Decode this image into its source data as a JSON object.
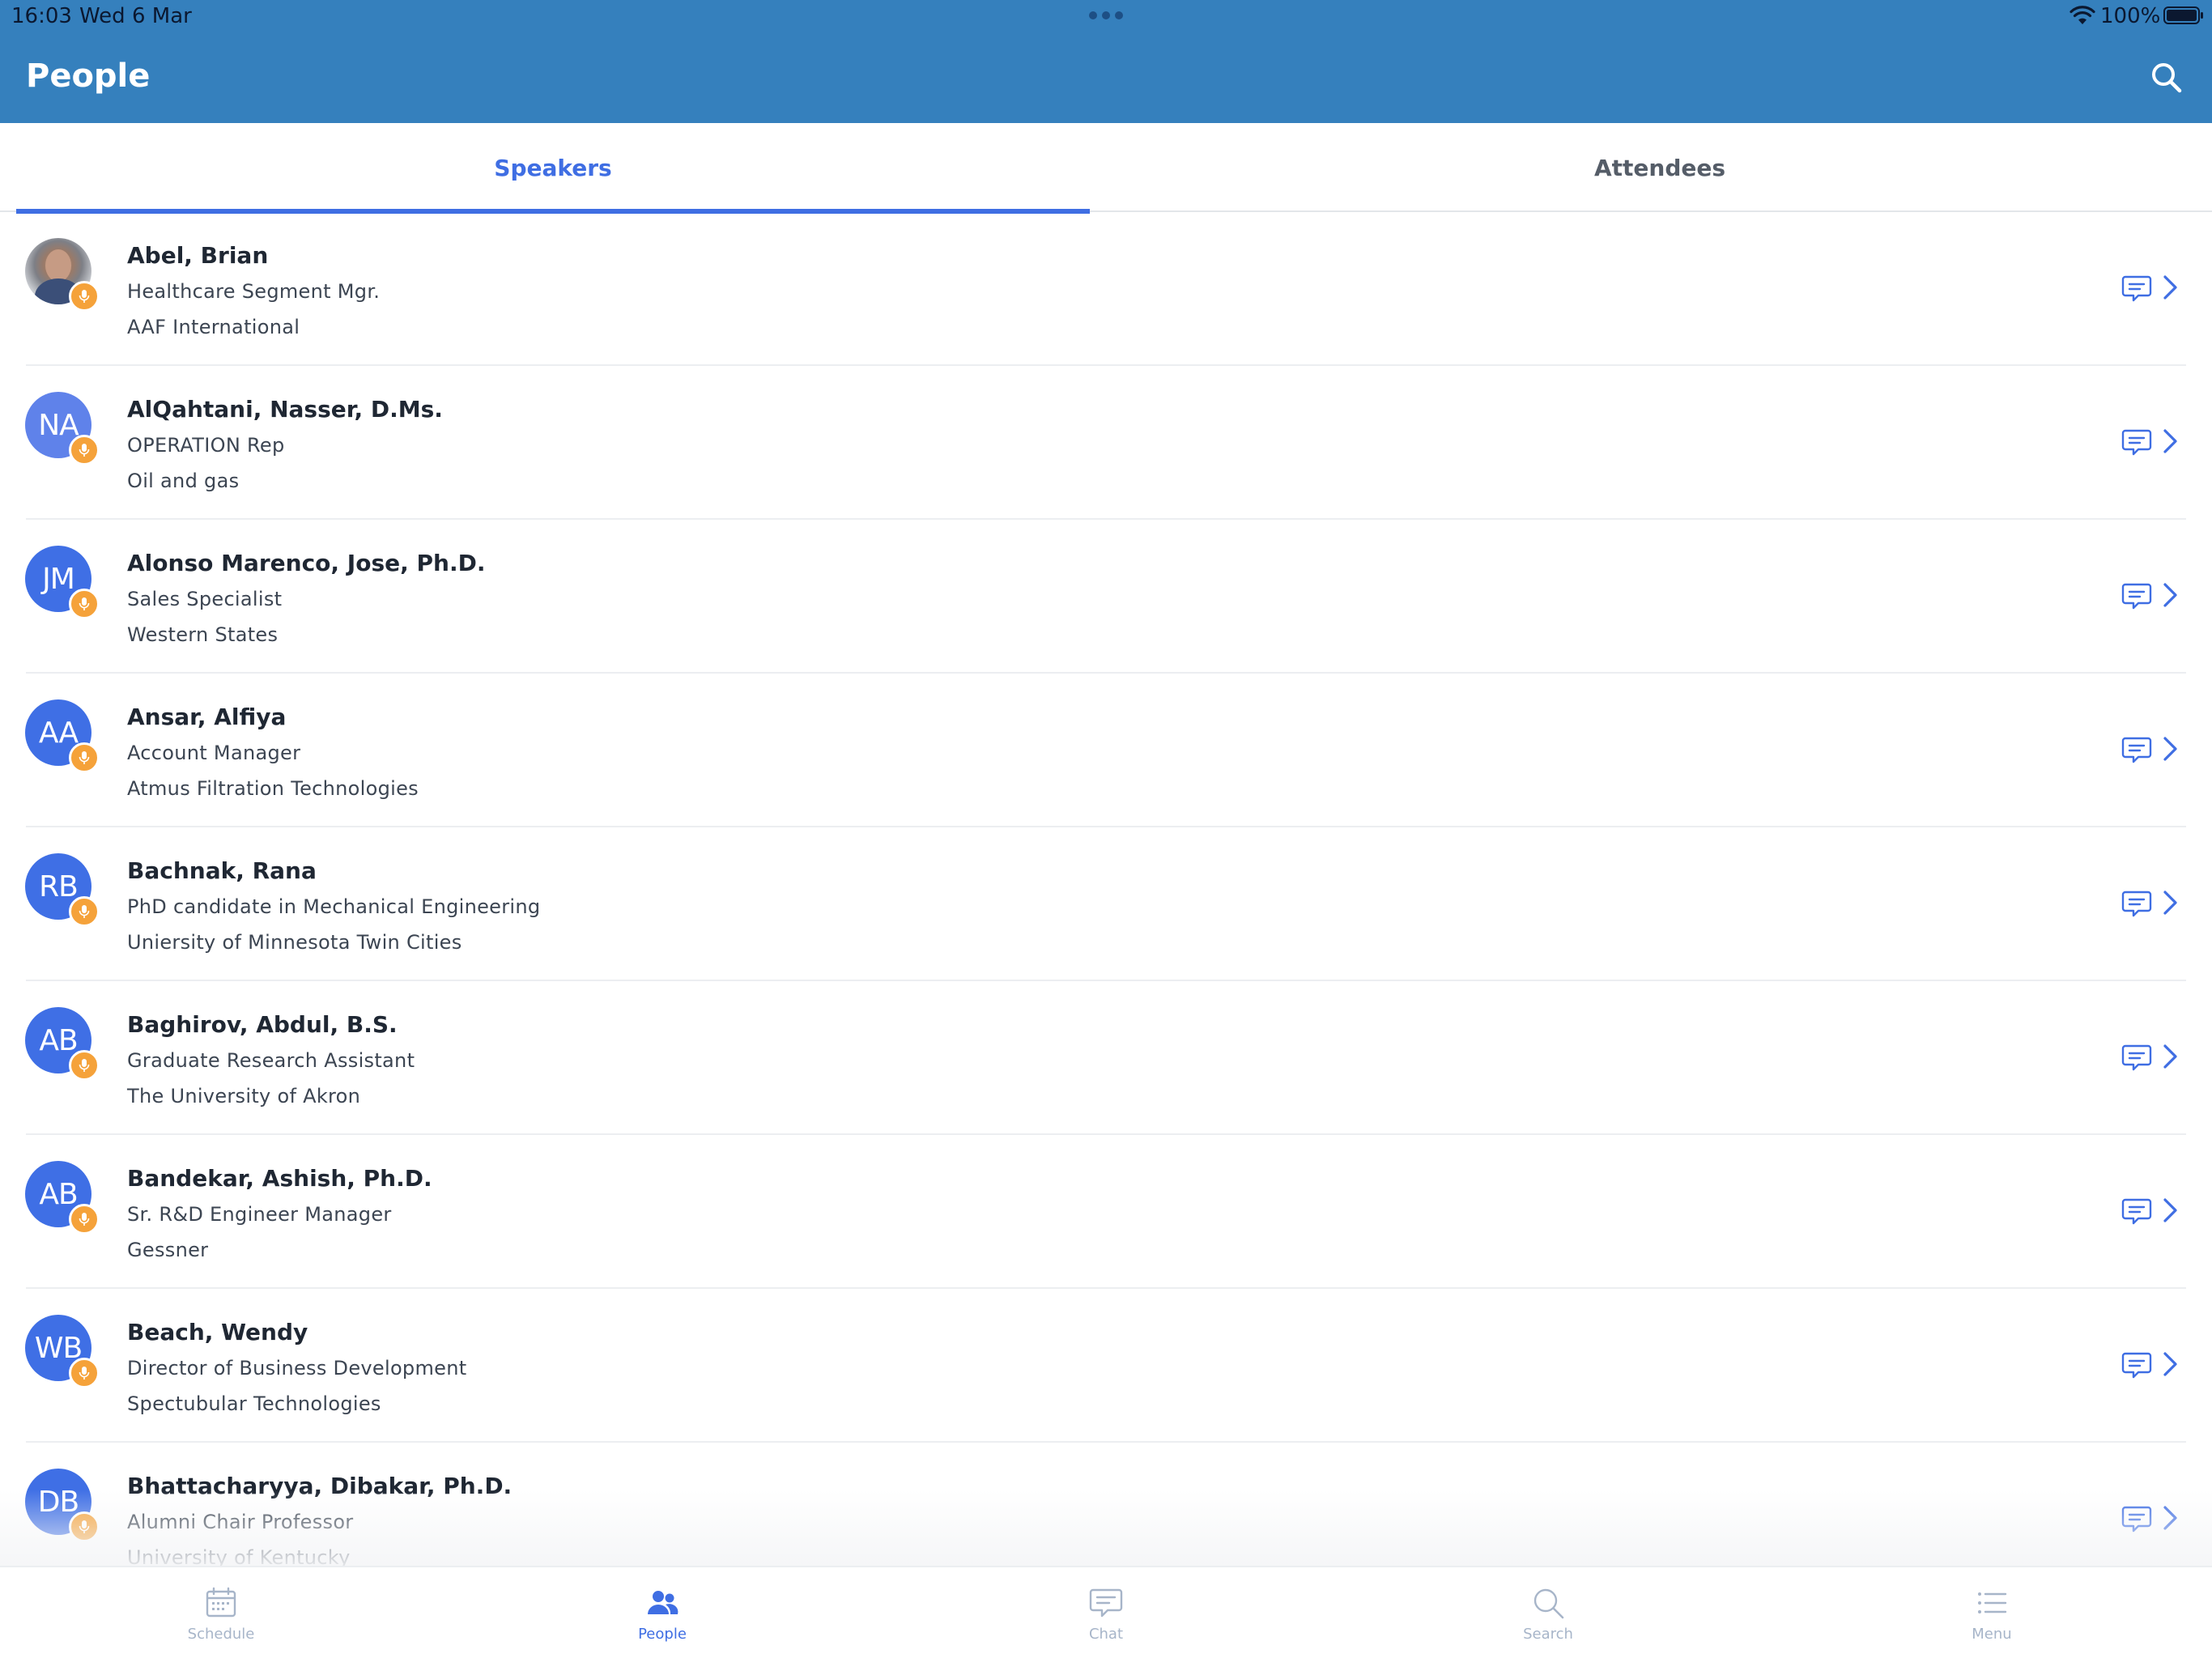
{
  "status_bar": {
    "time": "16:03",
    "date": "Wed 6 Mar",
    "battery": "100%"
  },
  "header": {
    "title": "People"
  },
  "tabs": [
    {
      "label": "Speakers",
      "active": true
    },
    {
      "label": "Attendees",
      "active": false
    }
  ],
  "people": [
    {
      "initials": "",
      "name": "Abel, Brian",
      "title": "Healthcare Segment Mgr.",
      "org": "AAF International"
    },
    {
      "initials": "NA",
      "name": "AlQahtani, Nasser, D.Ms.",
      "title": "OPERATION Rep",
      "org": "Oil and gas"
    },
    {
      "initials": "JM",
      "name": "Alonso Marenco, Jose, Ph.D.",
      "title": "Sales Specialist",
      "org": "Western States"
    },
    {
      "initials": "AA",
      "name": "Ansar, Alfiya",
      "title": "Account Manager",
      "org": "Atmus Filtration Technologies"
    },
    {
      "initials": "RB",
      "name": "Bachnak, Rana",
      "title": "PhD candidate in Mechanical Engineering",
      "org": "Uniersity of Minnesota Twin Cities"
    },
    {
      "initials": "AB",
      "name": "Baghirov, Abdul, B.S.",
      "title": "Graduate Research Assistant",
      "org": "The University of Akron"
    },
    {
      "initials": "AB",
      "name": "Bandekar, Ashish, Ph.D.",
      "title": "Sr. R&D Engineer Manager",
      "org": "Gessner"
    },
    {
      "initials": "WB",
      "name": "Beach, Wendy",
      "title": "Director of Business Development",
      "org": "Spectubular Technologies"
    },
    {
      "initials": "DB",
      "name": "Bhattacharyya, Dibakar, Ph.D.",
      "title": "Alumni Chair Professor",
      "org": "University of Kentucky"
    }
  ],
  "bottom_nav": [
    {
      "label": "Schedule",
      "icon": "calendar-icon",
      "active": false
    },
    {
      "label": "People",
      "icon": "people-icon",
      "active": true
    },
    {
      "label": "Chat",
      "icon": "chat-icon",
      "active": false
    },
    {
      "label": "Search",
      "icon": "search-icon",
      "active": false
    },
    {
      "label": "Menu",
      "icon": "menu-list-icon",
      "active": false
    }
  ],
  "colors": {
    "header_bg": "#3580bd",
    "accent": "#3f6ee3",
    "avatar_bg": "#3f6fe5",
    "speaker_badge": "#f5a23a",
    "nav_inactive": "#a7b5c9"
  }
}
